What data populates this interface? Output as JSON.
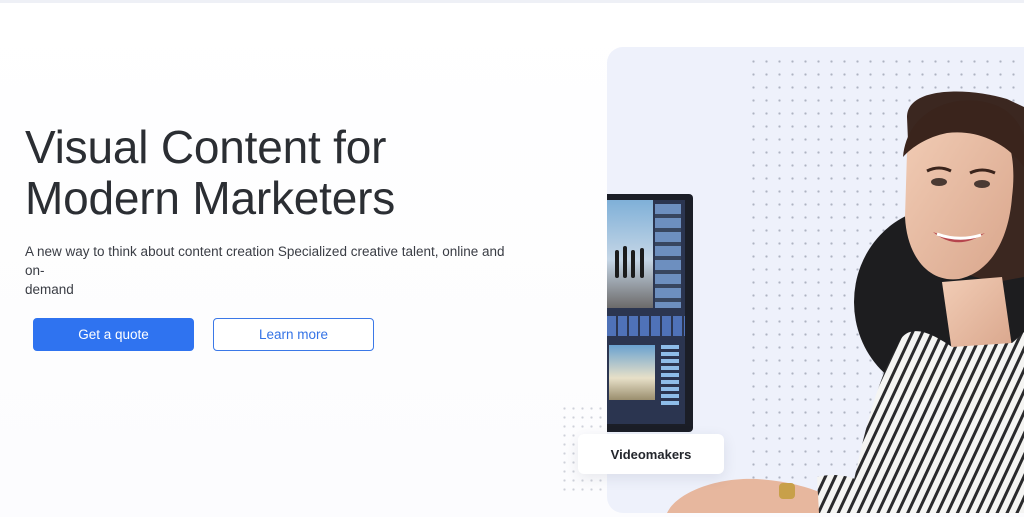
{
  "hero": {
    "title_line1": "Visual Content for",
    "title_line2": "Modern Marketers",
    "subtitle_line1": "A new way to think about content creation Specialized creative talent, online and on-",
    "subtitle_line2": "demand"
  },
  "buttons": {
    "primary_label": "Get a quote",
    "secondary_label": "Learn more"
  },
  "card": {
    "chip_label": "Videomakers"
  },
  "colors": {
    "accent": "#2f73f0",
    "card_bg": "#eef1fb",
    "dark_circle": "#1d1d1f"
  },
  "icons": [
    "monitor-illustration",
    "person-photo"
  ]
}
